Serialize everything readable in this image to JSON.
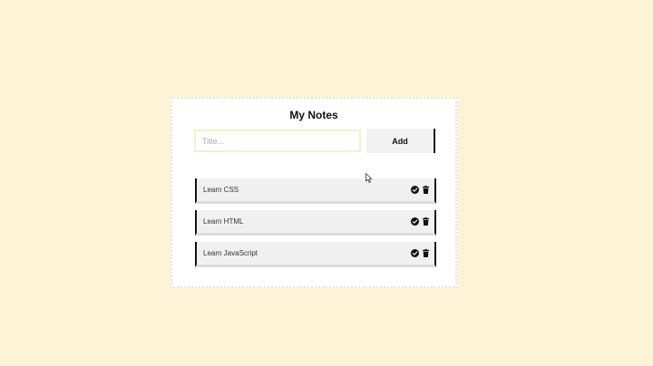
{
  "app": {
    "title": "My Notes"
  },
  "form": {
    "input_placeholder": "Title...",
    "input_value": "",
    "add_label": "Add"
  },
  "notes": [
    {
      "text": "Learn CSS"
    },
    {
      "text": "Learn HTML"
    },
    {
      "text": "Learn JavaScript"
    }
  ],
  "icons": {
    "complete": "check-circle-icon",
    "delete": "trash-icon"
  },
  "colors": {
    "page_background": "#fdf4d7",
    "card_background": "#ffffff",
    "accent_border": "#111111",
    "note_background": "#f1f0f1",
    "input_border": "#f6efc8"
  }
}
